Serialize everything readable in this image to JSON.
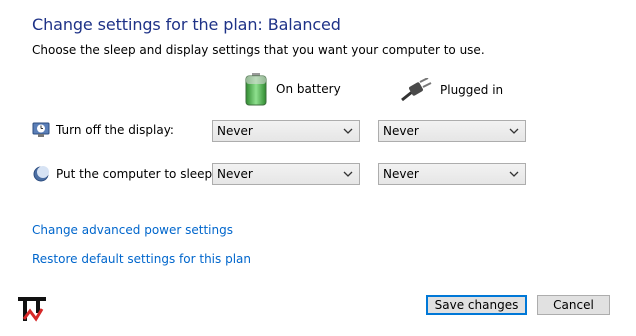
{
  "title": "Change settings for the plan: Balanced",
  "subtitle": "Choose the sleep and display settings that you want your computer to use.",
  "columns": {
    "battery": {
      "label": "On battery",
      "icon": "battery-icon"
    },
    "plugged": {
      "label": "Plugged in",
      "icon": "power-plug-icon"
    }
  },
  "rows": [
    {
      "label": "Turn off the display:",
      "icon": "display-timer-icon",
      "battery": "Never",
      "plugged": "Never"
    },
    {
      "label": "Put the computer to sleep:",
      "icon": "sleep-moon-icon",
      "battery": "Never",
      "plugged": "Never"
    }
  ],
  "links": {
    "advanced": "Change advanced power settings",
    "restore": "Restore default settings for this plan"
  },
  "buttons": {
    "save": "Save changes",
    "cancel": "Cancel"
  },
  "colors": {
    "title": "#1e3287",
    "link": "#0066cc",
    "primary_border": "#0078d7"
  }
}
